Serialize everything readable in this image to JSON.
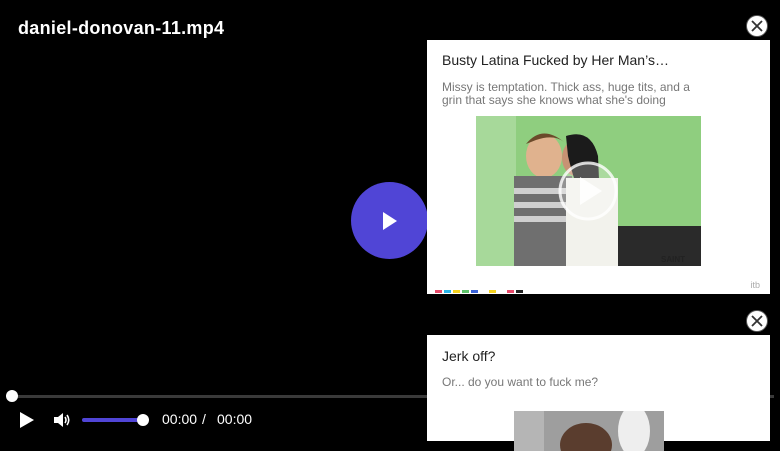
{
  "video": {
    "title": "daniel-donovan-11.mp4"
  },
  "controls": {
    "current_time": "00:00",
    "separator": "/",
    "duration": "00:00",
    "volume_level": 1.0,
    "progress": 0
  },
  "colors": {
    "accent": "#5045d6"
  },
  "ads": [
    {
      "title": "Busty Latina Fucked by Her Man’s…",
      "description": "Missy is temptation. Thick ass, huge tits, and a grin that says she knows what she's doing",
      "tag": "itb",
      "watermark": "SAINT"
    },
    {
      "title": "Jerk off?",
      "description": "Or... do you want to fuck me?"
    }
  ]
}
